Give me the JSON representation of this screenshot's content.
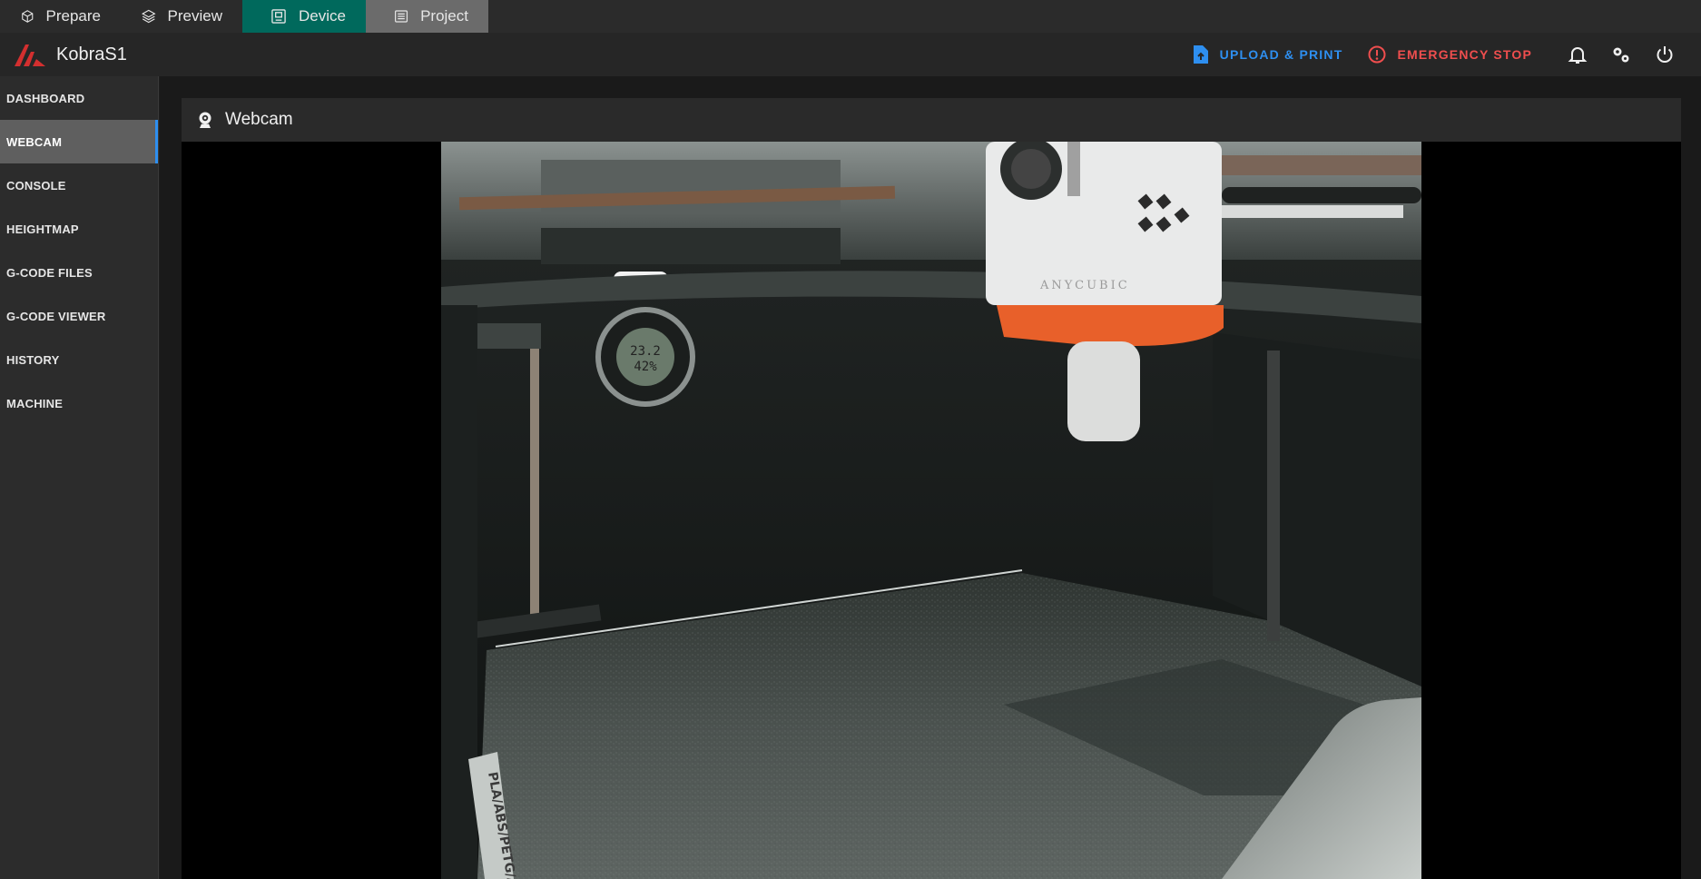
{
  "app_tabs": [
    {
      "label": "Prepare",
      "icon": "cube-icon"
    },
    {
      "label": "Preview",
      "icon": "layers-icon"
    },
    {
      "label": "Device",
      "icon": "device-icon",
      "active": true
    },
    {
      "label": "Project",
      "icon": "list-icon"
    }
  ],
  "header": {
    "printer_name": "KobraS1",
    "upload_label": "UPLOAD & PRINT",
    "stop_label": "EMERGENCY STOP",
    "icons": [
      "bell-icon",
      "gear-icon",
      "power-icon"
    ]
  },
  "sidebar": {
    "items": [
      {
        "label": "DASHBOARD"
      },
      {
        "label": "WEBCAM",
        "active": true
      },
      {
        "label": "CONSOLE"
      },
      {
        "label": "HEIGHTMAP"
      },
      {
        "label": "G-CODE FILES"
      },
      {
        "label": "G-CODE VIEWER"
      },
      {
        "label": "HISTORY"
      },
      {
        "label": "MACHINE"
      }
    ]
  },
  "webcam": {
    "title": "Webcam",
    "hygrometer_temp": "23.2",
    "hygrometer_humidity": "42%",
    "hotend_brand": "ANYCUBIC",
    "plate_text": "PLA/ABS/PETG/ASA"
  },
  "colors": {
    "device_tab": "#00695c",
    "project_tab": "#6b6b6b",
    "upload": "#2e8ff0",
    "stop": "#ef4e4e",
    "active_nav": "#5f5f5f",
    "hotend_orange": "#e8602a"
  }
}
